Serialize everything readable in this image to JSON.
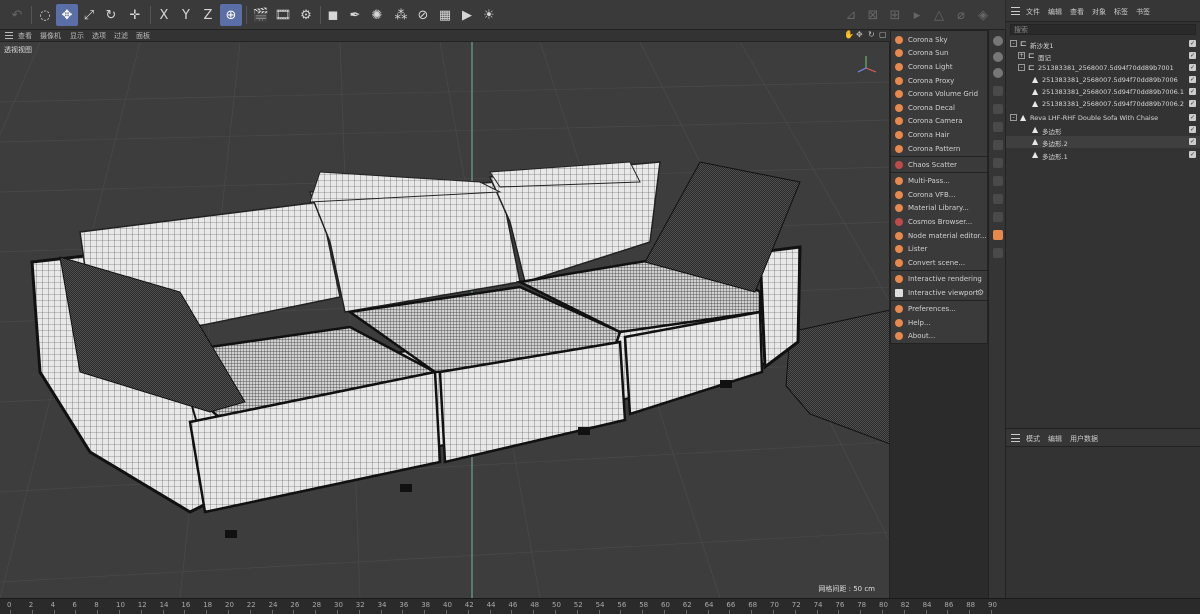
{
  "toolbar": {
    "axis_x": "X",
    "axis_y": "Y",
    "axis_z": "Z"
  },
  "viewport_menu": {
    "items": [
      "查看",
      "摄像机",
      "显示",
      "选项",
      "过滤",
      "面板"
    ]
  },
  "viewport": {
    "title": "透视视图",
    "grid_spacing": "网格间距 : 50 cm"
  },
  "corona_menu": {
    "items": [
      {
        "label": "Corona Sky",
        "color": "#e8884a"
      },
      {
        "label": "Corona Sun",
        "color": "#e8884a"
      },
      {
        "label": "Corona Light",
        "color": "#e8884a"
      },
      {
        "label": "Corona Proxy",
        "color": "#e8884a"
      },
      {
        "label": "Corona Volume Grid",
        "color": "#e8884a"
      },
      {
        "label": "Corona Decal",
        "color": "#e8884a"
      },
      {
        "label": "Corona Camera",
        "color": "#e8884a"
      },
      {
        "label": "Corona Hair",
        "color": "#e8884a"
      },
      {
        "label": "Corona Pattern",
        "color": "#e8884a"
      },
      {
        "label": "Chaos Scatter",
        "color": "#c04a4a"
      },
      {
        "label": "Multi-Pass...",
        "color": "#e8884a"
      },
      {
        "label": "Corona VFB...",
        "color": "#e8884a"
      },
      {
        "label": "Material Library...",
        "color": "#e8884a"
      },
      {
        "label": "Cosmos Browser...",
        "color": "#c04a4a"
      },
      {
        "label": "Node material editor...",
        "color": "#e8884a"
      },
      {
        "label": "Lister",
        "color": "#e8884a"
      },
      {
        "label": "Convert scene...",
        "color": "#e8884a"
      },
      {
        "label": "Interactive rendering",
        "color": "#e8884a"
      },
      {
        "label": "Interactive viewport",
        "color": "#dddddd"
      },
      {
        "label": "Preferences...",
        "color": "#e8884a"
      },
      {
        "label": "Help...",
        "color": "#e8884a"
      },
      {
        "label": "About...",
        "color": "#e8884a"
      }
    ]
  },
  "object_panel": {
    "menu": [
      "文件",
      "编辑",
      "查看",
      "对象",
      "标签",
      "书签"
    ],
    "search_placeholder": "搜索",
    "tree": [
      {
        "label": "新沙发1",
        "indent": 0,
        "expander": "-",
        "icon": "null"
      },
      {
        "label": "面记",
        "indent": 1,
        "expander": "+",
        "icon": "null"
      },
      {
        "label": "251383381_2568007.5d94f70dd89b7001",
        "indent": 1,
        "expander": "-",
        "icon": "null"
      },
      {
        "label": "251383381_2568007.5d94f70dd89b7006",
        "indent": 2,
        "expander": "",
        "icon": "mesh"
      },
      {
        "label": "251383381_2568007.5d94f70dd89b7006.1",
        "indent": 2,
        "expander": "",
        "icon": "mesh"
      },
      {
        "label": "251383381_2568007.5d94f70dd89b7006.2",
        "indent": 2,
        "expander": "",
        "icon": "mesh"
      },
      {
        "label": "Reva LHF-RHF Double Sofa With Chaise",
        "indent": 0,
        "expander": "-",
        "icon": "mesh"
      },
      {
        "label": "多边形",
        "indent": 1,
        "expander": "",
        "icon": "mesh"
      },
      {
        "label": "多边形.2",
        "indent": 1,
        "expander": "",
        "icon": "mesh"
      },
      {
        "label": "多边形.1",
        "indent": 1,
        "expander": "",
        "icon": "mesh"
      }
    ]
  },
  "attribute_panel": {
    "menu": [
      "模式",
      "编辑",
      "用户数据"
    ]
  },
  "timeline": {
    "ticks": [
      "0",
      "2",
      "4",
      "6",
      "8",
      "10",
      "12",
      "14",
      "16",
      "18",
      "20",
      "22",
      "24",
      "26",
      "28",
      "30",
      "32",
      "34",
      "36",
      "38",
      "40",
      "42",
      "44",
      "46",
      "48",
      "50",
      "52",
      "54",
      "56",
      "58",
      "60",
      "62",
      "64",
      "66",
      "68",
      "70",
      "72",
      "74",
      "76",
      "78",
      "80",
      "82",
      "84",
      "86",
      "88",
      "90"
    ]
  },
  "colors": {
    "accent": "#5a6ea8",
    "corona_orange": "#e8884a"
  }
}
